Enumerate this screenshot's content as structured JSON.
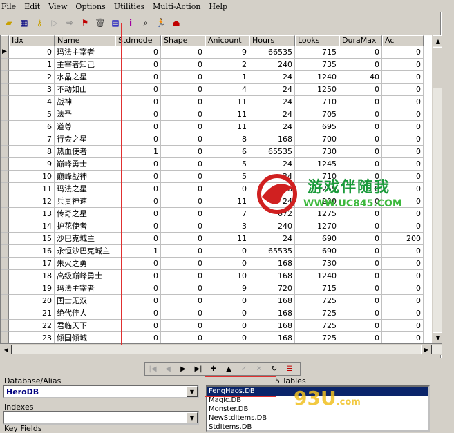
{
  "menu": [
    "File",
    "Edit",
    "View",
    "Options",
    "Utilities",
    "Multi-Action",
    "Help"
  ],
  "toolbar_icons": [
    "open-folder-icon",
    "table-icon",
    "key-icon",
    "arrow-right-icon",
    "export-icon",
    "filter-icon",
    "trash-icon",
    "database-icon",
    "info-icon",
    "lookup-icon",
    "run-icon",
    "exit-icon"
  ],
  "grid": {
    "columns": [
      "Idx",
      "Name",
      "Stdmode",
      "Shape",
      "Anicount",
      "Hours",
      "Looks",
      "DuraMax",
      "Ac"
    ],
    "rows": [
      [
        "0",
        "玛法主宰者",
        "0",
        "0",
        "9",
        "66535",
        "715",
        "0",
        "0"
      ],
      [
        "1",
        "主宰者知己",
        "0",
        "0",
        "2",
        "240",
        "735",
        "0",
        "0"
      ],
      [
        "2",
        "水晶之星",
        "0",
        "0",
        "1",
        "24",
        "1240",
        "40",
        "0"
      ],
      [
        "3",
        "不动如山",
        "0",
        "0",
        "4",
        "24",
        "1250",
        "0",
        "0"
      ],
      [
        "4",
        "战神",
        "0",
        "0",
        "11",
        "24",
        "710",
        "0",
        "0"
      ],
      [
        "5",
        "法圣",
        "0",
        "0",
        "11",
        "24",
        "705",
        "0",
        "0"
      ],
      [
        "6",
        "道尊",
        "0",
        "0",
        "11",
        "24",
        "695",
        "0",
        "0"
      ],
      [
        "7",
        "行会之星",
        "0",
        "0",
        "8",
        "168",
        "700",
        "0",
        "0"
      ],
      [
        "8",
        "热血使者",
        "1",
        "0",
        "6",
        "65535",
        "730",
        "0",
        "0"
      ],
      [
        "9",
        "巅峰勇士",
        "0",
        "0",
        "5",
        "24",
        "1245",
        "0",
        "0"
      ],
      [
        "10",
        "巅峰战神",
        "0",
        "0",
        "5",
        "24",
        "710",
        "0",
        "0"
      ],
      [
        "11",
        "玛法之星",
        "0",
        "0",
        "0",
        "336",
        "1255",
        "0",
        "0"
      ],
      [
        "12",
        "兵贵神速",
        "0",
        "0",
        "11",
        "24",
        "200",
        "0",
        "0"
      ],
      [
        "13",
        "传奇之星",
        "0",
        "0",
        "7",
        "672",
        "1275",
        "0",
        "0"
      ],
      [
        "14",
        "护花使者",
        "0",
        "0",
        "3",
        "240",
        "1270",
        "0",
        "0"
      ],
      [
        "15",
        "沙巴克城主",
        "0",
        "0",
        "11",
        "24",
        "690",
        "0",
        "200"
      ],
      [
        "16",
        "永恒沙巴克城主",
        "1",
        "0",
        "0",
        "65535",
        "690",
        "0",
        "0"
      ],
      [
        "17",
        "朱火之勇",
        "0",
        "0",
        "0",
        "168",
        "730",
        "0",
        "0"
      ],
      [
        "18",
        "高级巅峰勇士",
        "0",
        "0",
        "10",
        "168",
        "1240",
        "0",
        "0"
      ],
      [
        "19",
        "玛法主宰者",
        "0",
        "0",
        "9",
        "720",
        "715",
        "0",
        "0"
      ],
      [
        "20",
        "国士无双",
        "0",
        "0",
        "0",
        "168",
        "725",
        "0",
        "0"
      ],
      [
        "21",
        "绝代佳人",
        "0",
        "0",
        "0",
        "168",
        "725",
        "0",
        "0"
      ],
      [
        "22",
        "君临天下",
        "0",
        "0",
        "0",
        "168",
        "725",
        "0",
        "0"
      ],
      [
        "23",
        "倾国倾城",
        "0",
        "0",
        "0",
        "168",
        "725",
        "0",
        "0"
      ]
    ]
  },
  "database_label": "Database/Alias",
  "database_value": "HeroDB",
  "indexes_label": "Indexes",
  "keyfields_label": "Key Fields",
  "tables_count": "5 Tables",
  "tables": [
    "FengHaos.DB",
    "Magic.DB",
    "Monster.DB",
    "NewStdItems.DB",
    "StdItems.DB"
  ],
  "watermark": {
    "title": "游戏伴随我",
    "url": "WWW.UC845.COM",
    "logo2": "93U",
    "logo2_sub": ".com"
  }
}
